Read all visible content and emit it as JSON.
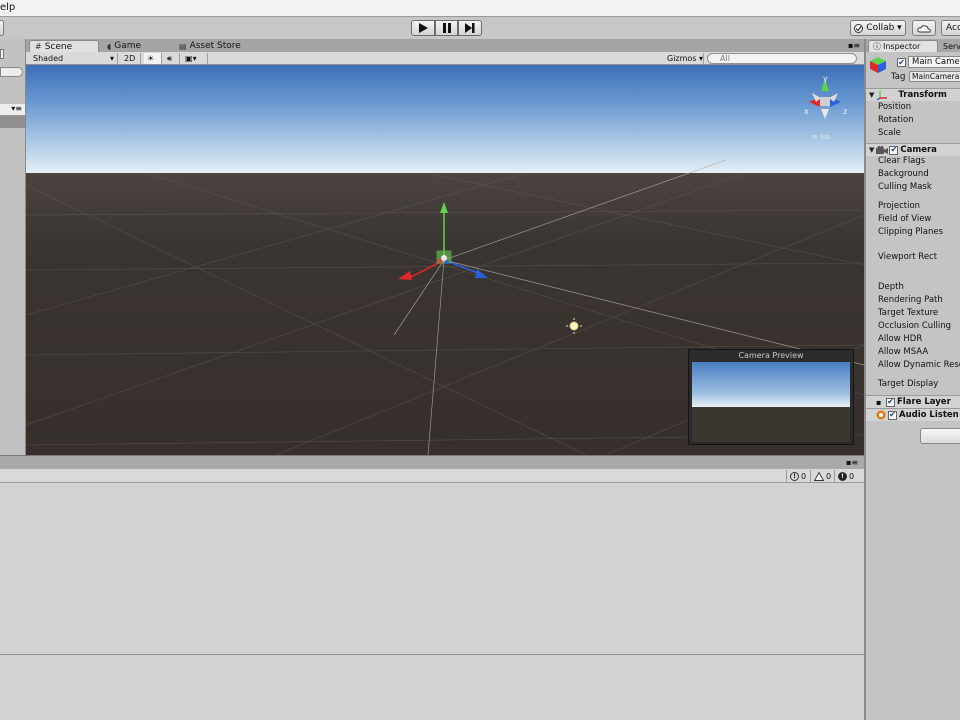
{
  "menubar": {
    "visible_text": "elp"
  },
  "toolbar": {
    "play_icon": "play-icon",
    "pause_icon": "pause-icon",
    "step_icon": "step-icon",
    "collab_label": "Collab ▾",
    "cloud_icon": "cloud-icon",
    "account_label": "Acc"
  },
  "tabs": {
    "scene": "Scene",
    "game": "Game",
    "asset_store": "Asset Store"
  },
  "scenebar": {
    "shading_mode": "Shaded",
    "mode_2d": "2D",
    "gizmos": "Gizmos",
    "search_placeholder": "All"
  },
  "scene": {
    "persp_label": "≡ Iso",
    "axis_y": "y",
    "axis_x": "x",
    "axis_z": "z"
  },
  "camera_preview": {
    "title": "Camera Preview"
  },
  "console": {
    "info_count": "0",
    "warning_count": "0",
    "error_count": "0"
  },
  "inspector": {
    "tab_inspector": "Inspector",
    "tab_services": "Serv",
    "object_name": "Main Camer",
    "tag_label": "Tag",
    "tag_value": "MainCamera",
    "transform": {
      "header": "Transform",
      "rows": [
        "Position",
        "Rotation",
        "Scale"
      ]
    },
    "camera": {
      "header": "Camera",
      "rows": [
        "Clear Flags",
        "Background",
        "Culling Mask",
        "Projection",
        "Field of View",
        "Clipping Planes",
        "Viewport Rect",
        "Depth",
        "Rendering Path",
        "Target Texture",
        "Occlusion Culling",
        "Allow HDR",
        "Allow MSAA",
        "Allow Dynamic Reso",
        "Target Display"
      ]
    },
    "flare_layer": "Flare Layer",
    "audio_listener": "Audio Listen"
  },
  "colors": {
    "sky_top": "#3c6fb8",
    "horizon": "#e8f2f7",
    "ground": "#3a3430",
    "axis_x": "#e02a2a",
    "axis_y": "#5fd34a",
    "axis_z": "#2a5fe0"
  }
}
